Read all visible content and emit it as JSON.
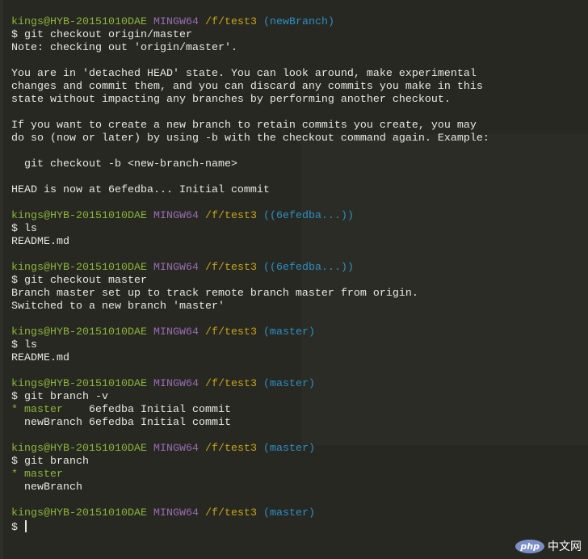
{
  "terminal": {
    "lines": [
      [
        {
          "t": "kings@HYB-20151010DAE",
          "c": "user"
        },
        {
          "t": " ",
          "c": "text"
        },
        {
          "t": "MINGW64",
          "c": "host"
        },
        {
          "t": " ",
          "c": "text"
        },
        {
          "t": "/f/test3",
          "c": "path"
        },
        {
          "t": " (newBranch)",
          "c": "branch"
        }
      ],
      [
        {
          "t": "$ git checkout origin/master",
          "c": "text"
        }
      ],
      [
        {
          "t": "Note: checking out 'origin/master'.",
          "c": "text"
        }
      ],
      [],
      [
        {
          "t": "You are in 'detached HEAD' state. You can look around, make experimental",
          "c": "text"
        }
      ],
      [
        {
          "t": "changes and commit them, and you can discard any commits you make in this",
          "c": "text"
        }
      ],
      [
        {
          "t": "state without impacting any branches by performing another checkout.",
          "c": "text"
        }
      ],
      [],
      [
        {
          "t": "If you want to create a new branch to retain commits you create, you may",
          "c": "text"
        }
      ],
      [
        {
          "t": "do so (now or later) by using -b with the checkout command again. Example:",
          "c": "text"
        }
      ],
      [],
      [
        {
          "t": "  git checkout -b <new-branch-name>",
          "c": "text"
        }
      ],
      [],
      [
        {
          "t": "HEAD is now at 6efedba... Initial commit",
          "c": "text"
        }
      ],
      [],
      [
        {
          "t": "kings@HYB-20151010DAE",
          "c": "user"
        },
        {
          "t": " ",
          "c": "text"
        },
        {
          "t": "MINGW64",
          "c": "host"
        },
        {
          "t": " ",
          "c": "text"
        },
        {
          "t": "/f/test3",
          "c": "path"
        },
        {
          "t": " ((6efedba...))",
          "c": "branch"
        }
      ],
      [
        {
          "t": "$ ls",
          "c": "text"
        }
      ],
      [
        {
          "t": "README.md",
          "c": "text"
        }
      ],
      [],
      [
        {
          "t": "kings@HYB-20151010DAE",
          "c": "user"
        },
        {
          "t": " ",
          "c": "text"
        },
        {
          "t": "MINGW64",
          "c": "host"
        },
        {
          "t": " ",
          "c": "text"
        },
        {
          "t": "/f/test3",
          "c": "path"
        },
        {
          "t": " ((6efedba...))",
          "c": "branch"
        }
      ],
      [
        {
          "t": "$ git checkout master",
          "c": "text"
        }
      ],
      [
        {
          "t": "Branch master set up to track remote branch master from origin.",
          "c": "text"
        }
      ],
      [
        {
          "t": "Switched to a new branch 'master'",
          "c": "text"
        }
      ],
      [],
      [
        {
          "t": "kings@HYB-20151010DAE",
          "c": "user"
        },
        {
          "t": " ",
          "c": "text"
        },
        {
          "t": "MINGW64",
          "c": "host"
        },
        {
          "t": " ",
          "c": "text"
        },
        {
          "t": "/f/test3",
          "c": "path"
        },
        {
          "t": " (master)",
          "c": "branch"
        }
      ],
      [
        {
          "t": "$ ls",
          "c": "text"
        }
      ],
      [
        {
          "t": "README.md",
          "c": "text"
        }
      ],
      [],
      [
        {
          "t": "kings@HYB-20151010DAE",
          "c": "user"
        },
        {
          "t": " ",
          "c": "text"
        },
        {
          "t": "MINGW64",
          "c": "host"
        },
        {
          "t": " ",
          "c": "text"
        },
        {
          "t": "/f/test3",
          "c": "path"
        },
        {
          "t": " (master)",
          "c": "branch"
        }
      ],
      [
        {
          "t": "$ git branch -v",
          "c": "text"
        }
      ],
      [
        {
          "t": "* master",
          "c": "cur"
        },
        {
          "t": "    6efedba Initial commit",
          "c": "text"
        }
      ],
      [
        {
          "t": "  newBranch 6efedba Initial commit",
          "c": "text"
        }
      ],
      [],
      [
        {
          "t": "kings@HYB-20151010DAE",
          "c": "user"
        },
        {
          "t": " ",
          "c": "text"
        },
        {
          "t": "MINGW64",
          "c": "host"
        },
        {
          "t": " ",
          "c": "text"
        },
        {
          "t": "/f/test3",
          "c": "path"
        },
        {
          "t": " (master)",
          "c": "branch"
        }
      ],
      [
        {
          "t": "$ git branch",
          "c": "text"
        }
      ],
      [
        {
          "t": "* master",
          "c": "cur"
        }
      ],
      [
        {
          "t": "  newBranch",
          "c": "text"
        }
      ],
      [],
      [
        {
          "t": "kings@HYB-20151010DAE",
          "c": "user"
        },
        {
          "t": " ",
          "c": "text"
        },
        {
          "t": "MINGW64",
          "c": "host"
        },
        {
          "t": " ",
          "c": "text"
        },
        {
          "t": "/f/test3",
          "c": "path"
        },
        {
          "t": " (master)",
          "c": "branch"
        }
      ],
      [
        {
          "t": "$ ",
          "c": "text"
        }
      ]
    ]
  },
  "watermark": {
    "logo": "php",
    "text": "中文网"
  },
  "colors": {
    "background": "#272822",
    "user": "#8bb43a",
    "host": "#9a6cb4",
    "path": "#c6a416",
    "branch": "#2c8fc4",
    "text": "#e8e8e2"
  }
}
